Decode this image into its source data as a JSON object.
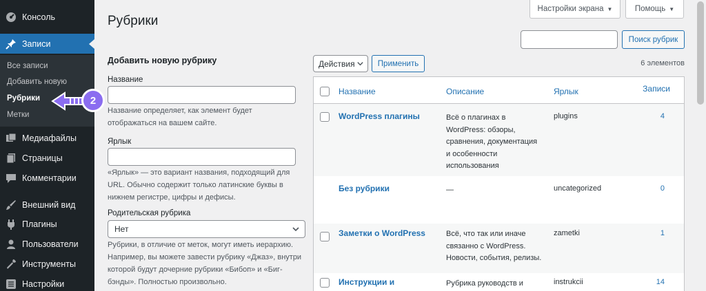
{
  "sidebar": {
    "items": [
      {
        "label": "Консоль",
        "icon": "dashboard-icon"
      },
      {
        "label": "Записи",
        "icon": "pin-icon",
        "current": true
      },
      {
        "label": "Медиафайлы",
        "icon": "media-icon"
      },
      {
        "label": "Страницы",
        "icon": "pages-icon"
      },
      {
        "label": "Комментарии",
        "icon": "comment-icon"
      },
      {
        "label": "Внешний вид",
        "icon": "brush-icon"
      },
      {
        "label": "Плагины",
        "icon": "plugin-icon"
      },
      {
        "label": "Пользователи",
        "icon": "users-icon"
      },
      {
        "label": "Инструменты",
        "icon": "wrench-icon"
      },
      {
        "label": "Настройки",
        "icon": "settings-icon"
      }
    ],
    "submenu": [
      {
        "label": "Все записи"
      },
      {
        "label": "Добавить новую"
      },
      {
        "label": "Рубрики",
        "current": true
      },
      {
        "label": "Метки"
      }
    ]
  },
  "annotation": {
    "badge": "2"
  },
  "header": {
    "screen_options": "Настройки экрана",
    "help": "Помощь",
    "title": "Рубрики"
  },
  "search": {
    "value": "",
    "button": "Поиск рубрик"
  },
  "form": {
    "heading": "Добавить новую рубрику",
    "name_label": "Название",
    "name_value": "",
    "name_desc": "Название определяет, как элемент будет отображаться на вашем сайте.",
    "slug_label": "Ярлык",
    "slug_value": "",
    "slug_desc": "«Ярлык» — это вариант названия, подходящий для URL. Обычно содержит только латинские буквы в нижнем регистре, цифры и дефисы.",
    "parent_label": "Родительская рубрика",
    "parent_value": "Нет",
    "parent_desc": "Рубрики, в отличие от меток, могут иметь иерархию. Например, вы можете завести рубрику «Джаз», внутри которой будут дочерние рубрики «Бибоп» и «Биг-бэнды». Полностью произвольно."
  },
  "bulk": {
    "select_value": "Действия",
    "apply": "Применить",
    "count": "6 элементов"
  },
  "table": {
    "headers": {
      "name": "Название",
      "desc": "Описание",
      "slug": "Ярлык",
      "count": "Записи"
    },
    "rows": [
      {
        "name": "WordPress плагины",
        "desc": "Всё о плагинах в WordPress: обзоры, сравнения, документация и особенности использования",
        "slug": "plugins",
        "count": "4"
      },
      {
        "name": "Без рубрики",
        "desc": "—",
        "slug": "uncategorized",
        "count": "0"
      },
      {
        "name": "Заметки о WordPress",
        "desc": "Всё, что так или иначе связанно с WordPress. Новости, события, релизы.",
        "slug": "zametki",
        "count": "1"
      },
      {
        "name": "Инструкции и",
        "desc": "Рубрика руководств и",
        "slug": "instrukcii",
        "count": "14"
      }
    ]
  },
  "colors": {
    "accent": "#2271b1",
    "sidebar": "#1d2327",
    "annotation": "#8b6df0"
  }
}
